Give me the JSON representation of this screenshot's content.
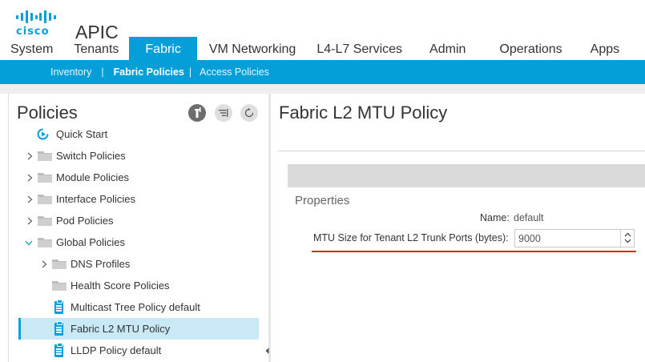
{
  "logo": {
    "text": "cisco",
    "color": "#049fd9"
  },
  "app": {
    "name": "APIC"
  },
  "nav": {
    "items": [
      {
        "label": "System"
      },
      {
        "label": "Tenants"
      },
      {
        "label": "Fabric",
        "active": true
      },
      {
        "label": "VM Networking"
      },
      {
        "label": "L4-L7 Services"
      },
      {
        "label": "Admin"
      },
      {
        "label": "Operations"
      },
      {
        "label": "Apps"
      }
    ]
  },
  "subnav": {
    "items": [
      {
        "label": "Inventory"
      },
      {
        "label": "Fabric Policies",
        "active": true
      },
      {
        "label": "Access Policies"
      }
    ],
    "separator": "|"
  },
  "left": {
    "title": "Policies",
    "tools": [
      "info-icon",
      "filter-list-icon",
      "refresh-icon"
    ],
    "tree": [
      {
        "label": "Quick Start",
        "icon": "quick-start-icon"
      },
      {
        "label": "Switch Policies",
        "icon": "folder-icon",
        "expander": "collapsed"
      },
      {
        "label": "Module Policies",
        "icon": "folder-icon",
        "expander": "collapsed"
      },
      {
        "label": "Interface Policies",
        "icon": "folder-icon",
        "expander": "collapsed"
      },
      {
        "label": "Pod Policies",
        "icon": "folder-icon",
        "expander": "collapsed"
      },
      {
        "label": "Global Policies",
        "icon": "folder-icon",
        "expander": "expanded"
      },
      {
        "label": "DNS Profiles",
        "icon": "folder-icon",
        "expander": "collapsed"
      },
      {
        "label": "Health Score Policies",
        "icon": "folder-icon"
      },
      {
        "label": "Multicast Tree Policy default",
        "icon": "policy-doc-icon"
      },
      {
        "label": "Fabric L2 MTU Policy",
        "icon": "policy-doc-icon",
        "selected": true
      },
      {
        "label": "LLDP Policy default",
        "icon": "policy-doc-icon"
      }
    ]
  },
  "right": {
    "title": "Fabric L2 MTU Policy",
    "properties_title": "Properties",
    "name_label": "Name:",
    "name_value": "default",
    "mtu_label": "MTU Size for Tenant L2 Trunk Ports (bytes):",
    "mtu_value": "9000"
  },
  "colors": {
    "accent": "#049fd9",
    "selected_row": "#c9e9f7",
    "highlight_underline": "#e2231a"
  }
}
